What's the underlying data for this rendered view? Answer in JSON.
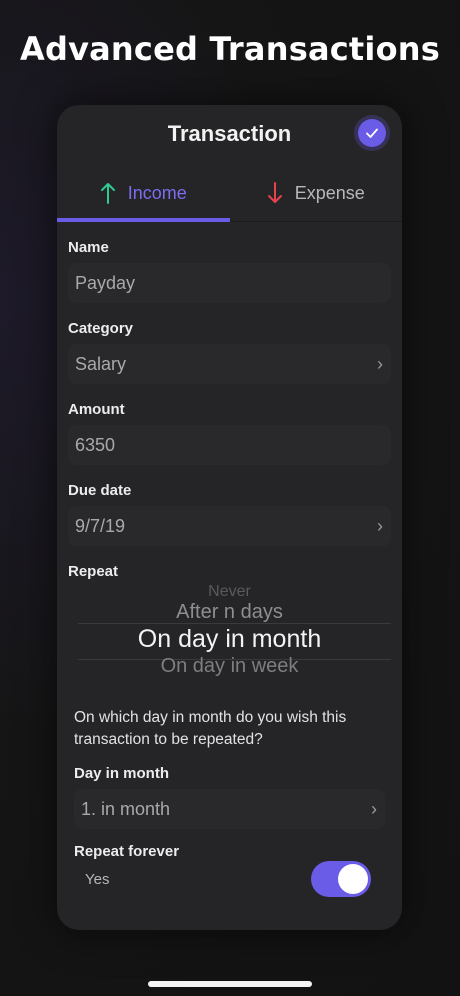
{
  "headline": "Advanced Transactions",
  "card": {
    "title": "Transaction",
    "confirm_icon": "checkmark-icon"
  },
  "tabs": [
    {
      "label": "Income",
      "icon": "arrow-up-icon",
      "active": true,
      "icon_color": "#2ecc8f"
    },
    {
      "label": "Expense",
      "icon": "arrow-down-icon",
      "active": false,
      "icon_color": "#e6434f"
    }
  ],
  "fields": {
    "name": {
      "label": "Name",
      "value": "Payday"
    },
    "category": {
      "label": "Category",
      "value": "Salary"
    },
    "amount": {
      "label": "Amount",
      "value": "6350"
    },
    "due_date": {
      "label": "Due date",
      "value": "9/7/19"
    }
  },
  "repeat": {
    "label": "Repeat",
    "options": [
      "Never",
      "After n days",
      "On day in month",
      "On day in week"
    ],
    "selected": "On day in month"
  },
  "description": "On which day in month do you wish this transaction to be repeated?",
  "day_in_month": {
    "label": "Day in month",
    "value": "1. in month"
  },
  "repeat_forever": {
    "label": "Repeat forever",
    "value": "Yes",
    "on": true
  },
  "colors": {
    "accent": "#6b5ce7",
    "income": "#2ecc8f",
    "expense": "#e6434f"
  }
}
